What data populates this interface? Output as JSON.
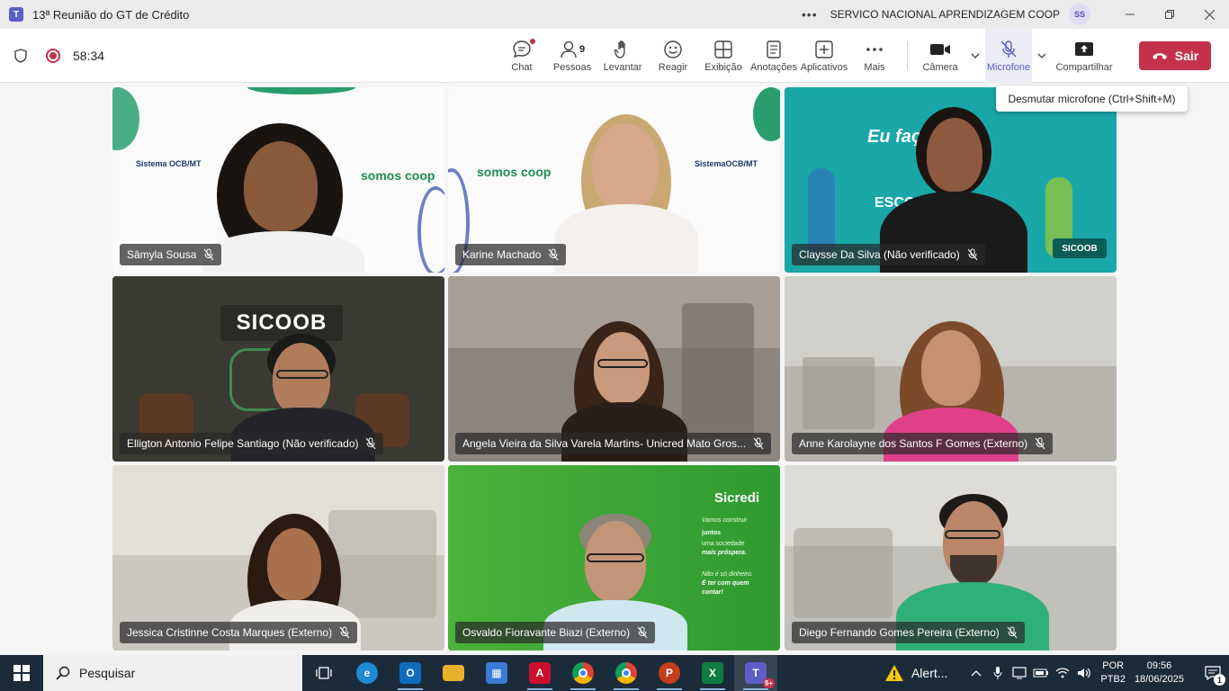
{
  "window": {
    "title": "13ª Reunião do GT de Crédito",
    "org": "SERVICO NACIONAL APRENDIZAGEM COOP",
    "avatar_initials": "SS",
    "controls": [
      "minimize",
      "restore",
      "close"
    ]
  },
  "meeting": {
    "elapsed": "58:34",
    "tools": [
      {
        "id": "chat",
        "label": "Chat",
        "icon": "chat-icon"
      },
      {
        "id": "people",
        "label": "Pessoas",
        "icon": "people-icon",
        "count": "9"
      },
      {
        "id": "raise",
        "label": "Levantar",
        "icon": "raise-hand-icon"
      },
      {
        "id": "react",
        "label": "Reagir",
        "icon": "smile-icon"
      },
      {
        "id": "view",
        "label": "Exibição",
        "icon": "grid-icon"
      },
      {
        "id": "notes",
        "label": "Anotações",
        "icon": "notes-icon"
      },
      {
        "id": "apps",
        "label": "Aplicativos",
        "icon": "plus-square-icon"
      },
      {
        "id": "more",
        "label": "Mais",
        "icon": "more-icon"
      }
    ],
    "camera_label": "Câmera",
    "mic_label": "Microfone",
    "share_label": "Compartilhar",
    "leave_label": "Sair",
    "tooltip": "Desmutar microfone (Ctrl+Shift+M)",
    "accent": "#5b5fc7",
    "leave_color": "#c4314b"
  },
  "participants": [
    {
      "name": "Sâmyla Sousa",
      "muted": true
    },
    {
      "name": "Karine Machado",
      "muted": true
    },
    {
      "name": "Claysse Da Silva (Não verificado)",
      "muted": true
    },
    {
      "name": "Elligton Antonio Felipe Santiago (Não verificado)",
      "muted": true
    },
    {
      "name": "Angela Vieira da Silva Varela Martins- Unicred Mato Gros...",
      "muted": true
    },
    {
      "name": "Anne Karolayne dos Santos F Gomes (Externo)",
      "muted": true
    },
    {
      "name": "Jessica Cristinne Costa Marques (Externo)",
      "muted": true
    },
    {
      "name": "Osvaldo Fioravante Biazi (Externo)",
      "muted": true
    },
    {
      "name": "Diego Fernando Gomes Pereira (Externo)",
      "muted": true
    }
  ],
  "backgrounds": {
    "t1_brand1": "Sistema OCB/MT",
    "t1_brand2": "somos coop",
    "t2_brand1": "somos coop",
    "t2_brand2": "SistemaOCB/MT",
    "t3_banner": "Eu faço parte",
    "t3_banner2": "ESCOLA",
    "t3_logo": "SICOOB",
    "t4_logo": "SICOOB",
    "t8_logo": "Sicredi",
    "t8_line1": "Vamos construir",
    "t8_line2": "juntos",
    "t8_line3": "uma sociedade",
    "t8_line4": "mais próspera.",
    "t8_line5": "Não é só dinheiro.",
    "t8_line6": "É ter com quem",
    "t8_line7": "contar!"
  },
  "taskbar": {
    "search_placeholder": "Pesquisar",
    "apps": [
      {
        "name": "task-view",
        "color": "#1c2b3a",
        "glyph": "▭"
      },
      {
        "name": "edge",
        "color": "#1f8ad2",
        "glyph": "e"
      },
      {
        "name": "outlook",
        "color": "#0f6cbd",
        "glyph": "O"
      },
      {
        "name": "file-explorer",
        "color": "#e8b12c",
        "glyph": "▬"
      },
      {
        "name": "store",
        "color": "#3a7bd5",
        "glyph": "▦"
      },
      {
        "name": "acrobat",
        "color": "#c8102e",
        "glyph": "A"
      },
      {
        "name": "chrome",
        "color": "#2a9d4b",
        "glyph": "●"
      },
      {
        "name": "chrome-2",
        "color": "#2a9d4b",
        "glyph": "●"
      },
      {
        "name": "powerpoint",
        "color": "#c43e1c",
        "glyph": "P"
      },
      {
        "name": "excel",
        "color": "#107c41",
        "glyph": "X"
      },
      {
        "name": "teams",
        "color": "#5b5fc7",
        "glyph": "T"
      }
    ],
    "teams_badge": "9+",
    "alert_label": "Alert...",
    "lang_line1": "POR",
    "lang_line2": "PTB2",
    "time": "09:56",
    "date": "18/06/2025",
    "notif_count": "1"
  }
}
